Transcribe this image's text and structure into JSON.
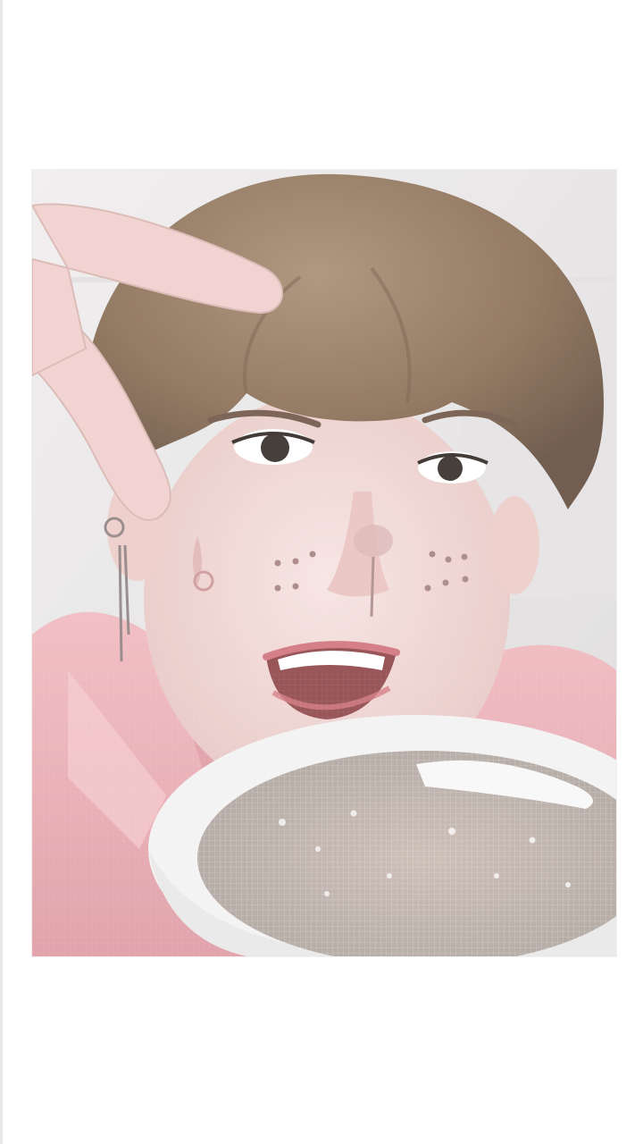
{
  "photo": {
    "subject": "selfie-photo",
    "colors": {
      "background": "#ffffff",
      "wall": "#e9e7e8",
      "hair": "#8a6e55",
      "skin": "#f2d6d3",
      "shirt": "#e9a7ae",
      "bowl": "#f3f3f3"
    }
  }
}
